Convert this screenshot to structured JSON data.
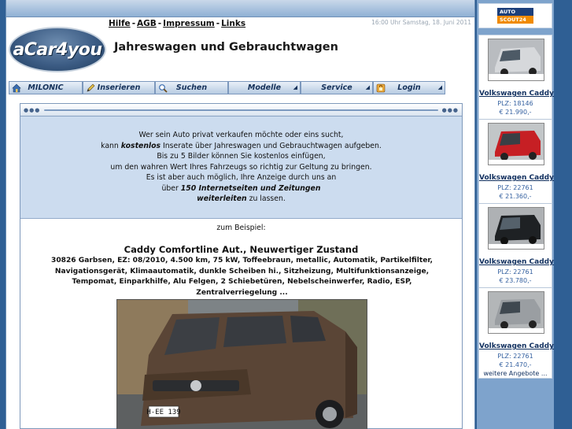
{
  "header": {
    "links": [
      "Hilfe",
      "AGB",
      "Impressum",
      "Links"
    ],
    "datetime": "16:00 Uhr Samstag, 18. Juni 2011",
    "logo_text": "aCar4you",
    "title": "Jahreswagen und Gebrauchtwagen"
  },
  "nav": [
    {
      "label": "MILONIC",
      "icon": "home-icon"
    },
    {
      "label": "Inserieren",
      "icon": "pencil-icon"
    },
    {
      "label": "Suchen",
      "icon": "magnifier-icon"
    },
    {
      "label": "Modelle",
      "icon": ""
    },
    {
      "label": "Service",
      "icon": ""
    },
    {
      "label": "Login",
      "icon": "lock-icon"
    }
  ],
  "intro": {
    "l1": "Wer sein Auto privat verkaufen möchte oder eins sucht,",
    "l2a": "kann ",
    "l2b": "kostenlos",
    "l2c": " Inserate über Jahreswagen und Gebrauchtwagen aufgeben.",
    "l3": "Bis zu 5 Bilder können Sie kostenlos einfügen,",
    "l4": "um den wahren Wert Ihres Fahrzeugs so richtig zur Geltung zu bringen.",
    "l5": "Es ist aber auch möglich, Ihre Anzeige durch uns an",
    "l6a": "über ",
    "l6b": "150 Internetseiten und Zeitungen",
    "l7a": "weiterleiten",
    "l7b": " zu lassen."
  },
  "example": {
    "label": "zum Beispiel:",
    "title": "Caddy Comfortline Aut., Neuwertiger Zustand",
    "description": "30826 Garbsen, EZ: 08/2010, 4.500 km, 75 kW, Toffeebraun, metallic, Automatik, Partikelfilter, Navigationsgerät, Klimaautomatik, dunkle Scheiben hi., Sitzheizung, Multifunktionsanzeige, Tempomat, Einparkhilfe, Alu Felgen, 2 Schiebetüren, Nebelscheinwerfer, Radio, ESP, Zentralverriegelung ...",
    "plate": "H-EE 139"
  },
  "sidebar": {
    "brand_top": "AUTO",
    "brand_bottom": "SCOUT24",
    "ads": [
      {
        "name": "Volkswagen Caddy",
        "plz": "PLZ: 18146",
        "price": "€ 21.990,-",
        "color": "#c9ccd0"
      },
      {
        "name": "Volkswagen Caddy",
        "plz": "PLZ: 22761",
        "price": "€ 21.360,-",
        "color": "#c61f24"
      },
      {
        "name": "Volkswagen Caddy",
        "plz": "PLZ: 22761",
        "price": "€ 23.780,-",
        "color": "#1e2124"
      },
      {
        "name": "Volkswagen Caddy",
        "plz": "PLZ: 22761",
        "price": "€ 21.470,-",
        "color": "#a7abaf"
      }
    ],
    "more": "weitere Angebote ..."
  }
}
